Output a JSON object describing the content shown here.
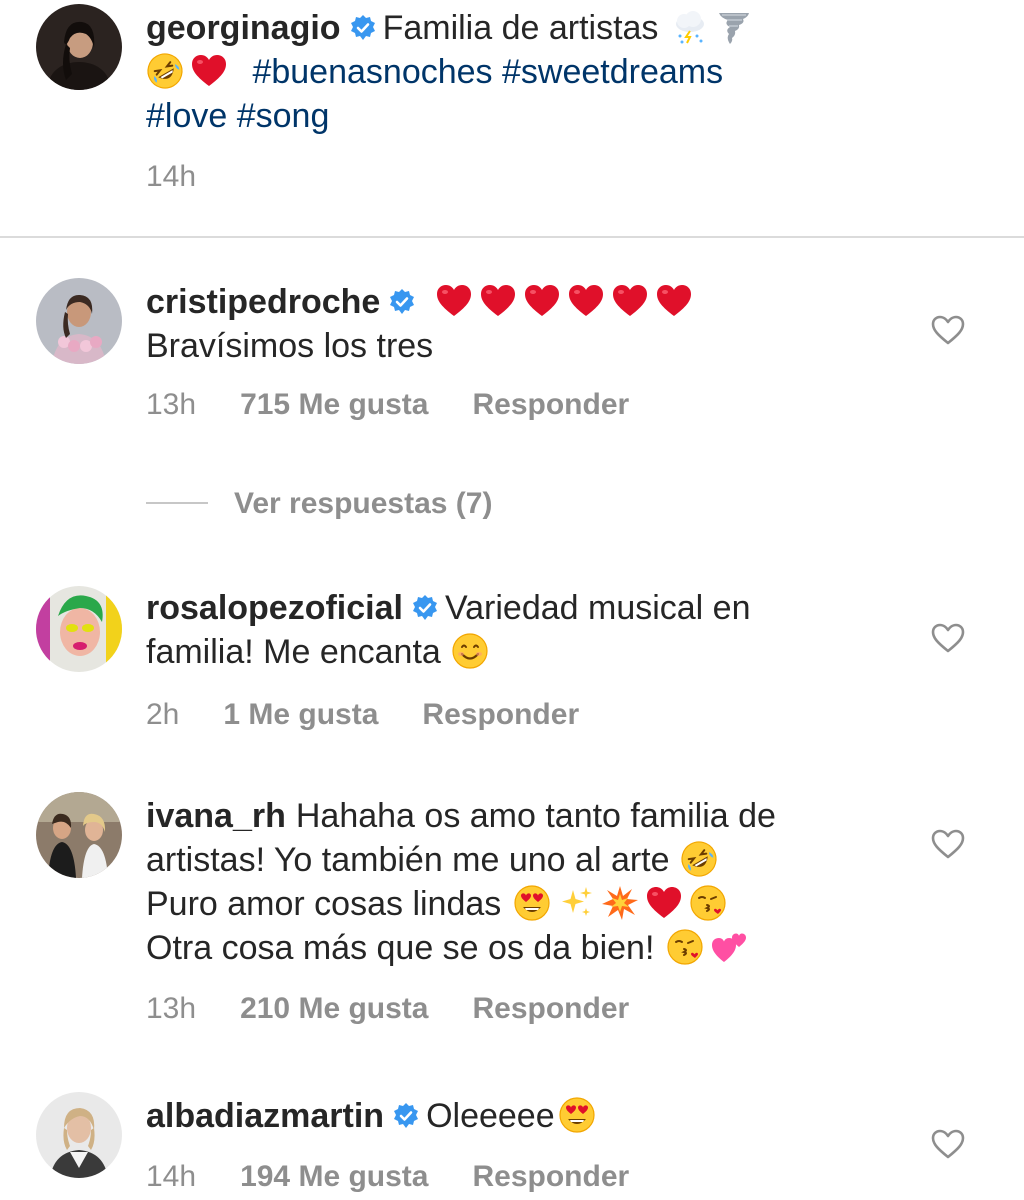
{
  "caption": {
    "username": "georginagio",
    "text_1": "Familia de artistas",
    "emojis_1": [
      "cloud-lightning-rain-emoji",
      "tornado-emoji"
    ],
    "emojis_2": [
      "rolling-laughing-emoji",
      "red-heart-emoji"
    ],
    "hashtags_line2": "#buenasnoches #sweetdreams",
    "hashtags_line3": "#love #song",
    "time": "14h"
  },
  "comments": [
    {
      "username": "cristipedroche",
      "verified": true,
      "text": "Bravísimos los tres",
      "lead_emojis": [
        "red-heart-emoji",
        "red-heart-emoji",
        "red-heart-emoji",
        "red-heart-emoji",
        "red-heart-emoji",
        "red-heart-emoji"
      ],
      "time": "13h",
      "likes": "715 Me gusta",
      "reply": "Responder"
    },
    {
      "username": "rosalopezoficial",
      "verified": true,
      "text_1": "Variedad musical en",
      "text_2": "familia! Me encanta",
      "emojis": [
        "smiling-face-emoji"
      ],
      "time": "2h",
      "likes": "1 Me gusta",
      "reply": "Responder"
    },
    {
      "username": "ivana_rh",
      "verified": false,
      "text_1": "Hahaha os amo tanto familia de",
      "text_2": "artistas! Yo también me uno al arte",
      "text_3": "Puro amor cosas lindas",
      "text_4": "Otra cosa más que se os da bien!",
      "emojis_2": [
        "rolling-laughing-emoji"
      ],
      "emojis_3": [
        "heart-eyes-emoji",
        "sparkles-emoji",
        "collision-emoji",
        "red-heart-emoji",
        "kiss-face-emoji"
      ],
      "emojis_4": [
        "kiss-face-emoji",
        "two-hearts-emoji"
      ],
      "time": "13h",
      "likes": "210 Me gusta",
      "reply": "Responder"
    },
    {
      "username": "albadiazmartin",
      "verified": true,
      "text": "Oleeeee",
      "emojis": [
        "heart-eyes-emoji"
      ],
      "time": "14h",
      "likes": "194 Me gusta",
      "reply": "Responder"
    }
  ],
  "view_replies": "Ver respuestas (7)",
  "colors": {
    "hashtag": "#003569",
    "verified": "#3897f0",
    "meta": "#8e8e8e",
    "heart_emoji": "#e0102a"
  }
}
